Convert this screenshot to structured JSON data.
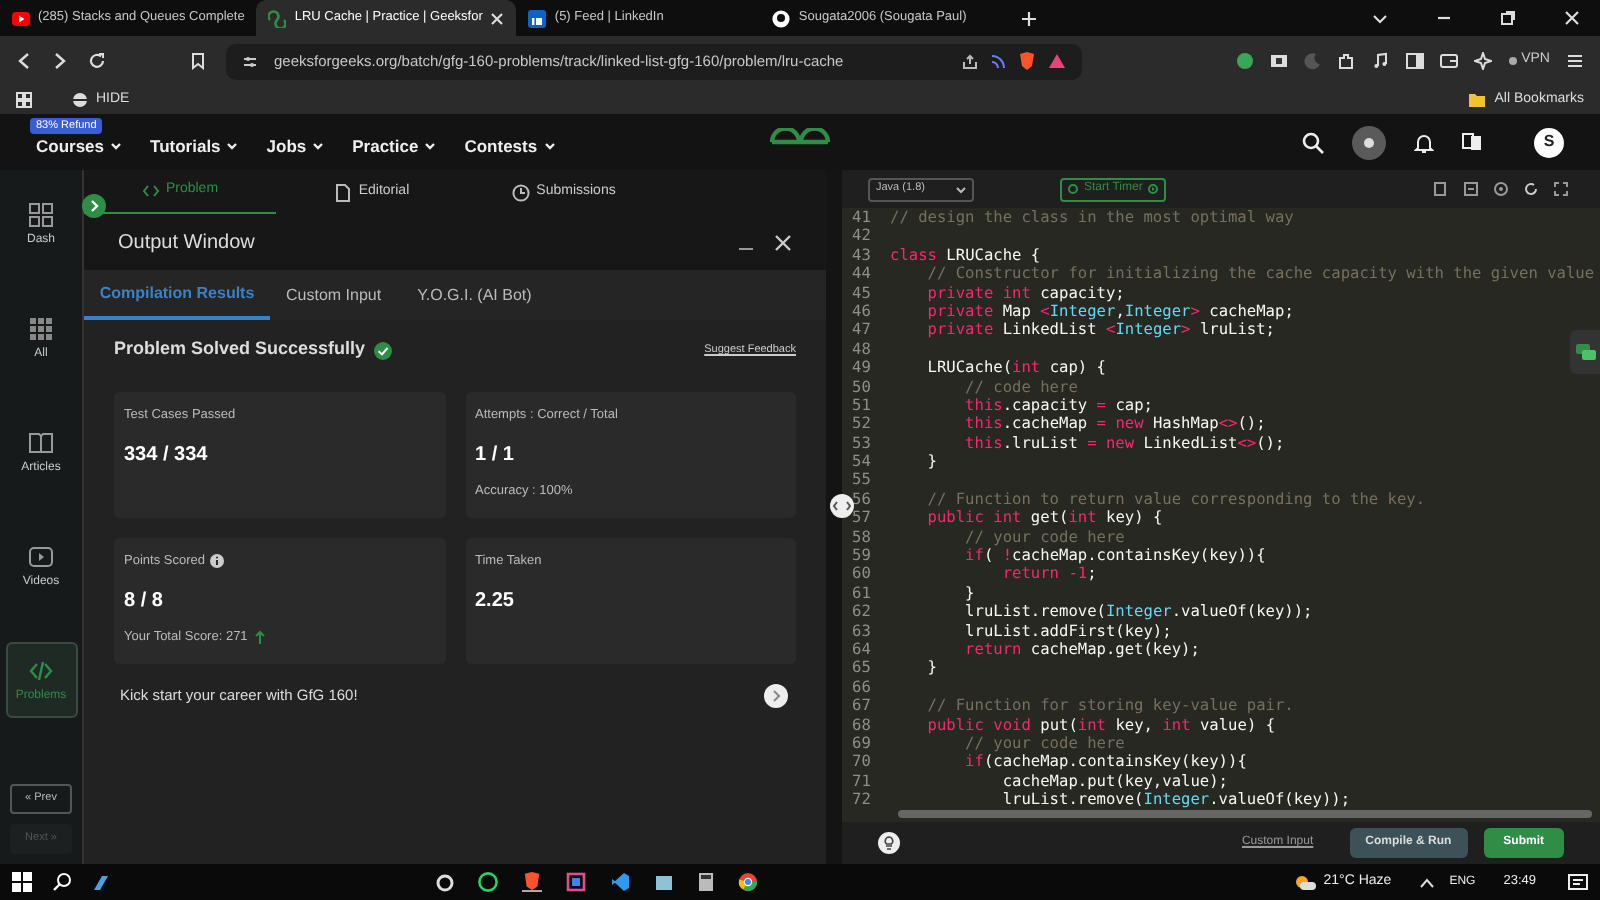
{
  "browser": {
    "tabs": [
      {
        "title": "(285) Stacks and Queues Complete",
        "selected": false
      },
      {
        "title": "LRU Cache | Practice | Geeksfor",
        "selected": true
      },
      {
        "title": "(5) Feed | LinkedIn",
        "selected": false
      },
      {
        "title": "Sougata2006 (Sougata Paul)",
        "selected": false
      }
    ],
    "url": "geeksforgeeks.org/batch/gfg-160-problems/track/linked-list-gfg-160/problem/lru-cache",
    "vpn_label": "VPN",
    "bookmarks": [
      {
        "label": "HIDE"
      }
    ],
    "all_bookmarks": "All Bookmarks"
  },
  "site_nav": {
    "badge": "83% Refund",
    "menu": [
      "Courses",
      "Tutorials",
      "Jobs",
      "Practice",
      "Contests"
    ],
    "avatar": "S"
  },
  "sidebar": {
    "items": [
      {
        "label": "Dash",
        "selected": false
      },
      {
        "label": "All",
        "selected": false
      },
      {
        "label": "Articles",
        "selected": false
      },
      {
        "label": "Videos",
        "selected": false
      },
      {
        "label": "Problems",
        "selected": true
      }
    ],
    "prev": {
      "label": "« Prev",
      "disabled": false
    },
    "next": {
      "label": "Next »",
      "disabled": true
    }
  },
  "problem_tabs": [
    {
      "label": "Problem",
      "selected": true
    },
    {
      "label": "Editorial",
      "selected": false
    },
    {
      "label": "Submissions",
      "selected": false
    }
  ],
  "output_window": {
    "title": "Output Window",
    "tabs": [
      {
        "label": "Compilation Results",
        "selected": true
      },
      {
        "label": "Custom Input",
        "selected": false
      },
      {
        "label": "Y.O.G.I. (AI Bot)",
        "selected": false
      }
    ],
    "status": "Problem Solved Successfully",
    "feedback_link": "Suggest Feedback",
    "cards": [
      {
        "label": "Test Cases Passed",
        "value": "334 / 334",
        "info_icon": false
      },
      {
        "label": "Attempts : Correct / Total",
        "value": "1 / 1",
        "info_icon": false,
        "note": {
          "text": "Accuracy : 100%",
          "up_arrow": false
        }
      },
      {
        "label": "Points Scored",
        "value": "8 / 8",
        "info_icon": true,
        "note": {
          "text": "Your Total Score: 271",
          "up_arrow": true
        }
      },
      {
        "label": "Time Taken",
        "value": "2.25",
        "info_icon": false
      }
    ],
    "promo": "Kick start your career with GfG 160!"
  },
  "editor": {
    "language": "Java (1.8)",
    "timer": "Start Timer",
    "lines": [
      {
        "number": "41",
        "tokens": [
          {
            "kind": "comment",
            "text": "// design the class in the most optimal way"
          }
        ]
      },
      {
        "number": "42"
      },
      {
        "number": "43",
        "tokens": [
          {
            "kind": "kw",
            "text": "class"
          },
          {
            "kind": "plain",
            "text": " LRUCache {"
          }
        ]
      },
      {
        "number": "44",
        "tokens": [
          {
            "kind": "comment",
            "text": "    // Constructor for initializing the cache capacity with the given value"
          }
        ]
      },
      {
        "number": "45",
        "tokens": [
          {
            "kind": "kw",
            "text": "    private"
          },
          {
            "kind": "kw",
            "text": " int"
          },
          {
            "kind": "plain",
            "text": " capacity;"
          }
        ]
      },
      {
        "number": "46",
        "tokens": [
          {
            "kind": "kw",
            "text": "    private"
          },
          {
            "kind": "plain",
            "text": " Map "
          },
          {
            "kind": "op",
            "text": "<"
          },
          {
            "kind": "type",
            "text": "Integer"
          },
          {
            "kind": "plain",
            "text": ","
          },
          {
            "kind": "type",
            "text": "Integer"
          },
          {
            "kind": "op",
            "text": ">"
          },
          {
            "kind": "plain",
            "text": " cacheMap;"
          }
        ]
      },
      {
        "number": "47",
        "tokens": [
          {
            "kind": "kw",
            "text": "    private"
          },
          {
            "kind": "plain",
            "text": " LinkedList "
          },
          {
            "kind": "op",
            "text": "<"
          },
          {
            "kind": "type",
            "text": "Integer"
          },
          {
            "kind": "op",
            "text": ">"
          },
          {
            "kind": "plain",
            "text": " lruList;"
          }
        ]
      },
      {
        "number": "48"
      },
      {
        "number": "49",
        "tokens": [
          {
            "kind": "plain",
            "text": "    LRUCache("
          },
          {
            "kind": "kw",
            "text": "int"
          },
          {
            "kind": "plain",
            "text": " cap) {"
          }
        ]
      },
      {
        "number": "50",
        "tokens": [
          {
            "kind": "comment",
            "text": "        // code here"
          }
        ]
      },
      {
        "number": "51",
        "tokens": [
          {
            "kind": "kw",
            "text": "        this"
          },
          {
            "kind": "plain",
            "text": ".capacity "
          },
          {
            "kind": "op",
            "text": "="
          },
          {
            "kind": "plain",
            "text": " cap;"
          }
        ]
      },
      {
        "number": "52",
        "tokens": [
          {
            "kind": "kw",
            "text": "        this"
          },
          {
            "kind": "plain",
            "text": ".cacheMap "
          },
          {
            "kind": "op",
            "text": "="
          },
          {
            "kind": "kw",
            "text": " new"
          },
          {
            "kind": "plain",
            "text": " HashMap"
          },
          {
            "kind": "op",
            "text": "<>"
          },
          {
            "kind": "plain",
            "text": "();"
          }
        ]
      },
      {
        "number": "53",
        "tokens": [
          {
            "kind": "kw",
            "text": "        this"
          },
          {
            "kind": "plain",
            "text": ".lruList "
          },
          {
            "kind": "op",
            "text": "="
          },
          {
            "kind": "kw",
            "text": " new"
          },
          {
            "kind": "plain",
            "text": " LinkedList"
          },
          {
            "kind": "op",
            "text": "<>"
          },
          {
            "kind": "plain",
            "text": "();"
          }
        ]
      },
      {
        "number": "54",
        "tokens": [
          {
            "kind": "plain",
            "text": "    }"
          }
        ]
      },
      {
        "number": "55"
      },
      {
        "number": "56",
        "tokens": [
          {
            "kind": "comment",
            "text": "    // Function to return value corresponding to the key."
          }
        ]
      },
      {
        "number": "57",
        "tokens": [
          {
            "kind": "kw",
            "text": "    public"
          },
          {
            "kind": "kw",
            "text": " int"
          },
          {
            "kind": "plain",
            "text": " get("
          },
          {
            "kind": "kw",
            "text": "int"
          },
          {
            "kind": "plain",
            "text": " key) {"
          }
        ]
      },
      {
        "number": "58",
        "tokens": [
          {
            "kind": "comment",
            "text": "        // your code here"
          }
        ]
      },
      {
        "number": "59",
        "tokens": [
          {
            "kind": "kw",
            "text": "        if"
          },
          {
            "kind": "plain",
            "text": "( "
          },
          {
            "kind": "op",
            "text": "!"
          },
          {
            "kind": "plain",
            "text": "cacheMap.containsKey(key)){"
          }
        ]
      },
      {
        "number": "60",
        "tokens": [
          {
            "kind": "kw",
            "text": "            return"
          },
          {
            "kind": "kw",
            "text": " -1"
          },
          {
            "kind": "plain",
            "text": ";"
          }
        ]
      },
      {
        "number": "61",
        "tokens": [
          {
            "kind": "plain",
            "text": "        }"
          }
        ]
      },
      {
        "number": "62",
        "tokens": [
          {
            "kind": "plain",
            "text": "        lruList.remove("
          },
          {
            "kind": "type",
            "text": "Integer"
          },
          {
            "kind": "plain",
            "text": ".valueOf(key));"
          }
        ]
      },
      {
        "number": "63",
        "tokens": [
          {
            "kind": "plain",
            "text": "        lruList.addFirst(key);"
          }
        ]
      },
      {
        "number": "64",
        "tokens": [
          {
            "kind": "kw",
            "text": "        return"
          },
          {
            "kind": "plain",
            "text": " cacheMap.get(key);"
          }
        ]
      },
      {
        "number": "65",
        "tokens": [
          {
            "kind": "plain",
            "text": "    }"
          }
        ]
      },
      {
        "number": "66"
      },
      {
        "number": "67",
        "tokens": [
          {
            "kind": "comment",
            "text": "    // Function for storing key-value pair."
          }
        ]
      },
      {
        "number": "68",
        "tokens": [
          {
            "kind": "kw",
            "text": "    public"
          },
          {
            "kind": "kw",
            "text": " void"
          },
          {
            "kind": "plain",
            "text": " put("
          },
          {
            "kind": "kw",
            "text": "int"
          },
          {
            "kind": "plain",
            "text": " key, "
          },
          {
            "kind": "kw",
            "text": "int"
          },
          {
            "kind": "plain",
            "text": " value) {"
          }
        ]
      },
      {
        "number": "69",
        "tokens": [
          {
            "kind": "comment",
            "text": "        // your code here"
          }
        ]
      },
      {
        "number": "70",
        "tokens": [
          {
            "kind": "kw",
            "text": "        if"
          },
          {
            "kind": "plain",
            "text": "(cacheMap.containsKey(key)){"
          }
        ]
      },
      {
        "number": "71",
        "tokens": [
          {
            "kind": "plain",
            "text": "            cacheMap.put(key,value);"
          }
        ]
      },
      {
        "number": "72",
        "tokens": [
          {
            "kind": "plain",
            "text": "            lruList.remove("
          },
          {
            "kind": "type",
            "text": "Integer"
          },
          {
            "kind": "plain",
            "text": ".valueOf(key));"
          }
        ]
      }
    ],
    "custom_input": "Custom Input",
    "compile": "Compile & Run",
    "submit": "Submit"
  },
  "taskbar": {
    "weather": "21°C Haze",
    "language": "ENG",
    "time": "23:49"
  }
}
